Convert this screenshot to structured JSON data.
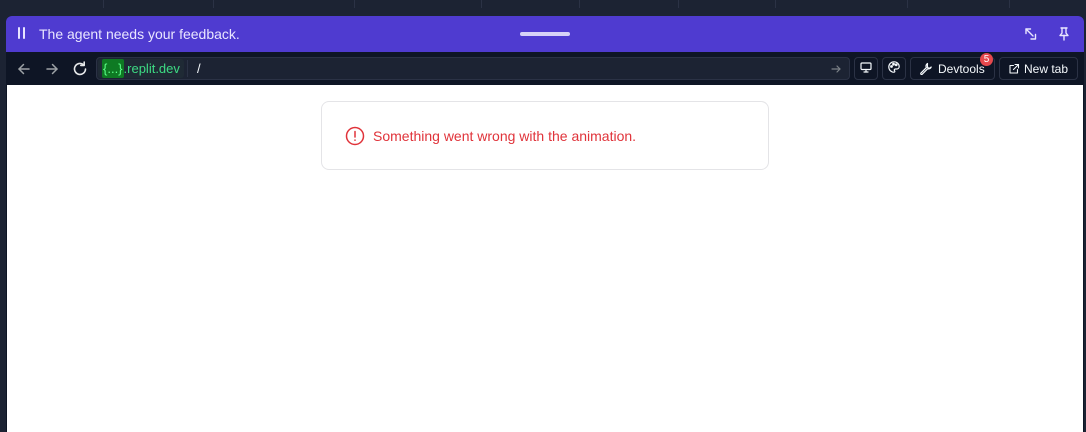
{
  "banner": {
    "message": "The agent needs your feedback."
  },
  "toolbar": {
    "url_host_highlight": "{...}",
    "url_host_rest": ".replit.dev",
    "url_path": "/",
    "devtools_label": "Devtools",
    "devtools_badge": "5",
    "new_tab_label": "New tab"
  },
  "content": {
    "error_message": "Something went wrong with the animation."
  },
  "colors": {
    "banner": "#4f3bd0",
    "error": "#e0333a",
    "host_text": "#3ddc84",
    "badge": "#e5484d"
  }
}
